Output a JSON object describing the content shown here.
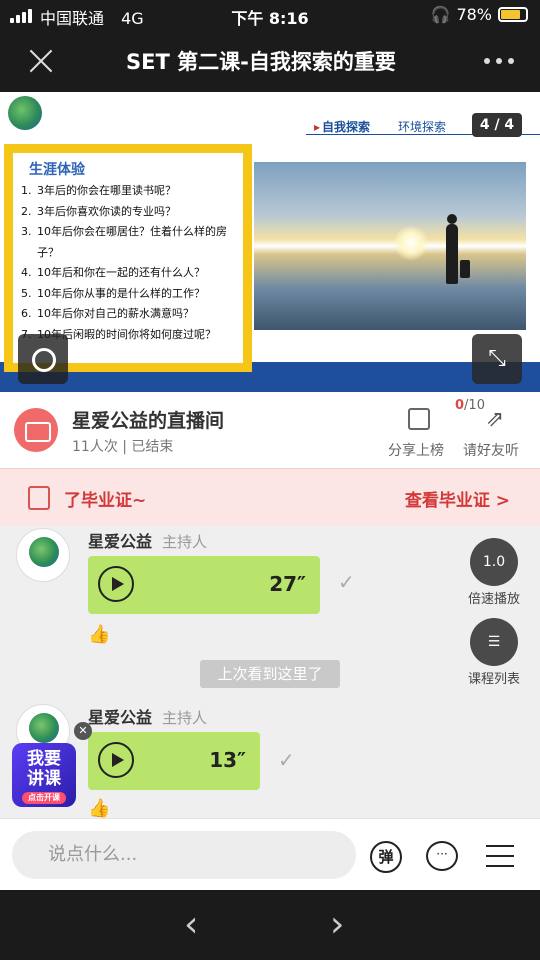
{
  "status": {
    "carrier": "中国联通",
    "network": "4G",
    "time": "下午 8:16",
    "battery": "78%"
  },
  "header": {
    "title": "SET 第二课-自我探索的重要"
  },
  "slide": {
    "nav_active": "自我探索",
    "nav_other": "环境探索",
    "page": "4 / 4",
    "box_title": "生涯体验",
    "items": [
      {
        "n": "1.",
        "t": "3年后的你会在哪里读书呢？"
      },
      {
        "n": "2.",
        "t": "3年后你喜欢你读的专业吗？"
      },
      {
        "n": "3.",
        "t": "10年后你会在哪居住？住着什么样的房子？"
      },
      {
        "n": "4.",
        "t": "10年后和你在一起的还有什么人？"
      },
      {
        "n": "5.",
        "t": "10年后你从事的是什么样的工作？"
      },
      {
        "n": "6.",
        "t": "10年后你对自己的薪水满意吗？"
      },
      {
        "n": "7.",
        "t": "10年后闲暇的时间你将如何度过呢？"
      }
    ]
  },
  "room": {
    "name": "星爱公益的直播间",
    "meta": "11人次 | 已结束",
    "counter_num": "0",
    "counter_total": "/10",
    "share_label": "分享上榜",
    "invite_label": "请好友听"
  },
  "cert": {
    "left_text": "了毕业证~",
    "right_text": "查看毕业证 >"
  },
  "chat": {
    "messages": [
      {
        "sender": "星爱公益",
        "role": "主持人",
        "duration": "27″"
      },
      {
        "sender": "星爱公益",
        "role": "主持人",
        "duration": "13″"
      }
    ],
    "resume_label": "上次看到这里了",
    "speed_label": "倍速播放",
    "speed_value": "1.0",
    "course_list_label": "课程列表",
    "promo_line1": "我要",
    "promo_line2": "讲课",
    "promo_small": "点击开课"
  },
  "input": {
    "placeholder": "说点什么...",
    "danmu_label": "弹"
  }
}
